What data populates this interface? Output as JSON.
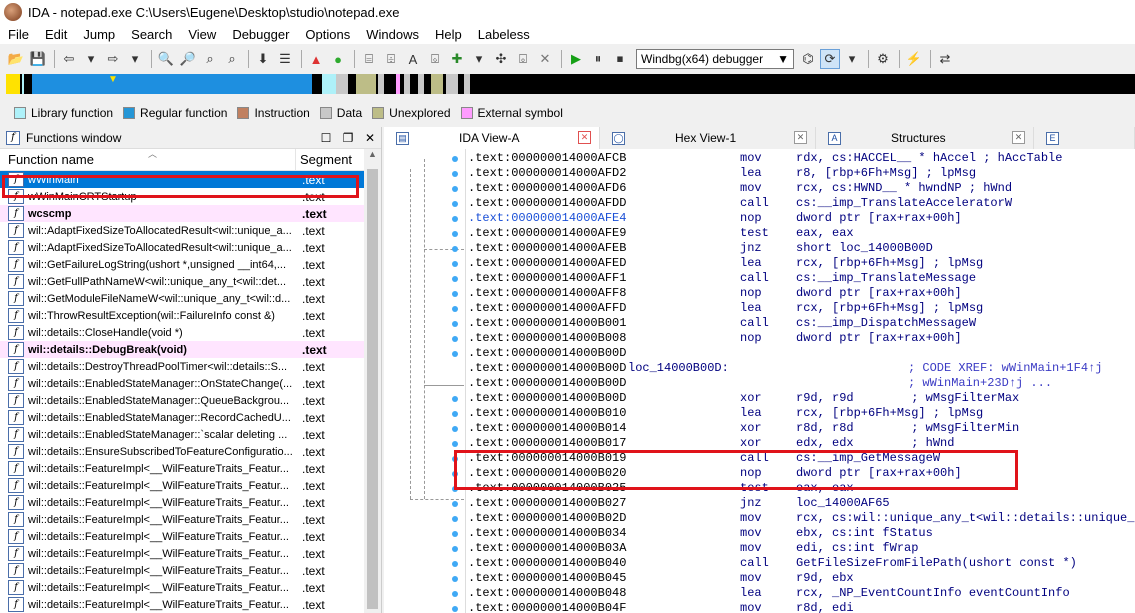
{
  "window": {
    "title": "IDA - notepad.exe C:\\Users\\Eugene\\Desktop\\studio\\notepad.exe"
  },
  "menu": [
    "File",
    "Edit",
    "Jump",
    "Search",
    "View",
    "Debugger",
    "Options",
    "Windows",
    "Help",
    "Labeless"
  ],
  "toolbar": {
    "debugger_select": "Windbg(x64) debugger"
  },
  "legend": [
    {
      "label": "Library function",
      "color": "#aef1f9"
    },
    {
      "label": "Regular function",
      "color": "#2596d6"
    },
    {
      "label": "Instruction",
      "color": "#c08060"
    },
    {
      "label": "Data",
      "color": "#c8c8c8"
    },
    {
      "label": "Unexplored",
      "color": "#bdbd87"
    },
    {
      "label": "External symbol",
      "color": "#ff9cff"
    }
  ],
  "functions_window": {
    "title": "Functions window",
    "col_name": "Function name",
    "col_segment": "Segment",
    "rows": [
      {
        "name": "wWinMain",
        "seg": ".text",
        "kind": "sel"
      },
      {
        "name": "wWinMainCRTStartup",
        "seg": ".text",
        "kind": ""
      },
      {
        "name": "wcscmp",
        "seg": ".text",
        "kind": "lib"
      },
      {
        "name": "wil::AdaptFixedSizeToAllocatedResult<wil::unique_a...",
        "seg": ".text",
        "kind": ""
      },
      {
        "name": "wil::AdaptFixedSizeToAllocatedResult<wil::unique_a...",
        "seg": ".text",
        "kind": ""
      },
      {
        "name": "wil::GetFailureLogString(ushort *,unsigned __int64,...",
        "seg": ".text",
        "kind": ""
      },
      {
        "name": "wil::GetFullPathNameW<wil::unique_any_t<wil::det...",
        "seg": ".text",
        "kind": ""
      },
      {
        "name": "wil::GetModuleFileNameW<wil::unique_any_t<wil::d...",
        "seg": ".text",
        "kind": ""
      },
      {
        "name": "wil::ThrowResultException(wil::FailureInfo const &)",
        "seg": ".text",
        "kind": ""
      },
      {
        "name": "wil::details::CloseHandle(void *)",
        "seg": ".text",
        "kind": ""
      },
      {
        "name": "wil::details::DebugBreak(void)",
        "seg": ".text",
        "kind": "lib"
      },
      {
        "name": "wil::details::DestroyThreadPoolTimer<wil::details::S...",
        "seg": ".text",
        "kind": ""
      },
      {
        "name": "wil::details::EnabledStateManager::OnStateChange(...",
        "seg": ".text",
        "kind": ""
      },
      {
        "name": "wil::details::EnabledStateManager::QueueBackgrou...",
        "seg": ".text",
        "kind": ""
      },
      {
        "name": "wil::details::EnabledStateManager::RecordCachedU...",
        "seg": ".text",
        "kind": ""
      },
      {
        "name": "wil::details::EnabledStateManager::`scalar deleting ...",
        "seg": ".text",
        "kind": ""
      },
      {
        "name": "wil::details::EnsureSubscribedToFeatureConfiguratio...",
        "seg": ".text",
        "kind": ""
      },
      {
        "name": "wil::details::FeatureImpl<__WilFeatureTraits_Featur...",
        "seg": ".text",
        "kind": ""
      },
      {
        "name": "wil::details::FeatureImpl<__WilFeatureTraits_Featur...",
        "seg": ".text",
        "kind": ""
      },
      {
        "name": "wil::details::FeatureImpl<__WilFeatureTraits_Featur...",
        "seg": ".text",
        "kind": ""
      },
      {
        "name": "wil::details::FeatureImpl<__WilFeatureTraits_Featur...",
        "seg": ".text",
        "kind": ""
      },
      {
        "name": "wil::details::FeatureImpl<__WilFeatureTraits_Featur...",
        "seg": ".text",
        "kind": ""
      },
      {
        "name": "wil::details::FeatureImpl<__WilFeatureTraits_Featur...",
        "seg": ".text",
        "kind": ""
      },
      {
        "name": "wil::details::FeatureImpl<__WilFeatureTraits_Featur...",
        "seg": ".text",
        "kind": ""
      },
      {
        "name": "wil::details::FeatureImpl<__WilFeatureTraits_Featur...",
        "seg": ".text",
        "kind": ""
      },
      {
        "name": "wil::details::FeatureImpl<__WilFeatureTraits_Featur...",
        "seg": ".text",
        "kind": ""
      }
    ]
  },
  "tabs": [
    {
      "label": "IDA View-A",
      "icon": "I"
    },
    {
      "label": "Hex View-1",
      "icon": "O"
    },
    {
      "label": "Structures",
      "icon": "A"
    },
    {
      "label": "",
      "icon": "E"
    }
  ],
  "disasm": [
    {
      "addr": ".text:000000014000AFCB",
      "mn": "mov",
      "op": "rdx, cs:HACCEL__ * hAccel ; hAccTable"
    },
    {
      "addr": ".text:000000014000AFD2",
      "mn": "lea",
      "op": "r8, [rbp+6Fh+Msg] ; lpMsg"
    },
    {
      "addr": ".text:000000014000AFD6",
      "mn": "mov",
      "op": "rcx, cs:HWND__ * hwndNP ; hWnd"
    },
    {
      "addr": ".text:000000014000AFDD",
      "mn": "call",
      "op": "cs:__imp_TranslateAcceleratorW"
    },
    {
      "addr": ".text:000000014000AFE4",
      "mn": "nop",
      "op": "dword ptr [rax+rax+00h]",
      "blue": true
    },
    {
      "addr": ".text:000000014000AFE9",
      "mn": "test",
      "op": "eax, eax"
    },
    {
      "addr": ".text:000000014000AFEB",
      "mn": "jnz",
      "op": "short loc_14000B00D"
    },
    {
      "addr": ".text:000000014000AFED",
      "mn": "lea",
      "op": "rcx, [rbp+6Fh+Msg] ; lpMsg"
    },
    {
      "addr": ".text:000000014000AFF1",
      "mn": "call",
      "op": "cs:__imp_TranslateMessage"
    },
    {
      "addr": ".text:000000014000AFF8",
      "mn": "nop",
      "op": "dword ptr [rax+rax+00h]"
    },
    {
      "addr": ".text:000000014000AFFD",
      "mn": "lea",
      "op": "rcx, [rbp+6Fh+Msg] ; lpMsg"
    },
    {
      "addr": ".text:000000014000B001",
      "mn": "call",
      "op": "cs:__imp_DispatchMessageW"
    },
    {
      "addr": ".text:000000014000B008",
      "mn": "nop",
      "op": "dword ptr [rax+rax+00h]"
    },
    {
      "addr": ".text:000000014000B00D",
      "mn": "",
      "op": ""
    },
    {
      "addr": ".text:000000014000B00D",
      "label": "loc_14000B00D:",
      "cm": "; CODE XREF: wWinMain+1F4↑j"
    },
    {
      "addr": ".text:000000014000B00D",
      "cm": "; wWinMain+23D↑j ..."
    },
    {
      "addr": ".text:000000014000B00D",
      "mn": "xor",
      "op": "r9d, r9d        ; wMsgFilterMax"
    },
    {
      "addr": ".text:000000014000B010",
      "mn": "lea",
      "op": "rcx, [rbp+6Fh+Msg] ; lpMsg"
    },
    {
      "addr": ".text:000000014000B014",
      "mn": "xor",
      "op": "r8d, r8d        ; wMsgFilterMin"
    },
    {
      "addr": ".text:000000014000B017",
      "mn": "xor",
      "op": "edx, edx        ; hWnd"
    },
    {
      "addr": ".text:000000014000B019",
      "mn": "call",
      "op": "cs:__imp_GetMessageW"
    },
    {
      "addr": ".text:000000014000B020",
      "mn": "nop",
      "op": "dword ptr [rax+rax+00h]"
    },
    {
      "addr": ".text:000000014000B025",
      "mn": "test",
      "op": "eax, eax"
    },
    {
      "addr": ".text:000000014000B027",
      "mn": "jnz",
      "op": "loc_14000AF65"
    },
    {
      "addr": ".text:000000014000B02D",
      "mn": "mov",
      "op": "rcx, cs:wil::unique_any_t<wil::details::unique_st"
    },
    {
      "addr": ".text:000000014000B034",
      "mn": "mov",
      "op": "ebx, cs:int fStatus"
    },
    {
      "addr": ".text:000000014000B03A",
      "mn": "mov",
      "op": "edi, cs:int fWrap"
    },
    {
      "addr": ".text:000000014000B040",
      "mn": "call",
      "op": "GetFileSizeFromFilePath(ushort const *)"
    },
    {
      "addr": ".text:000000014000B045",
      "mn": "mov",
      "op": "r9d, ebx"
    },
    {
      "addr": ".text:000000014000B048",
      "mn": "lea",
      "op": "rcx, _NP_EventCountInfo eventCountInfo"
    },
    {
      "addr": ".text:000000014000B04F",
      "mn": "mov",
      "op": "r8d, edi"
    }
  ]
}
